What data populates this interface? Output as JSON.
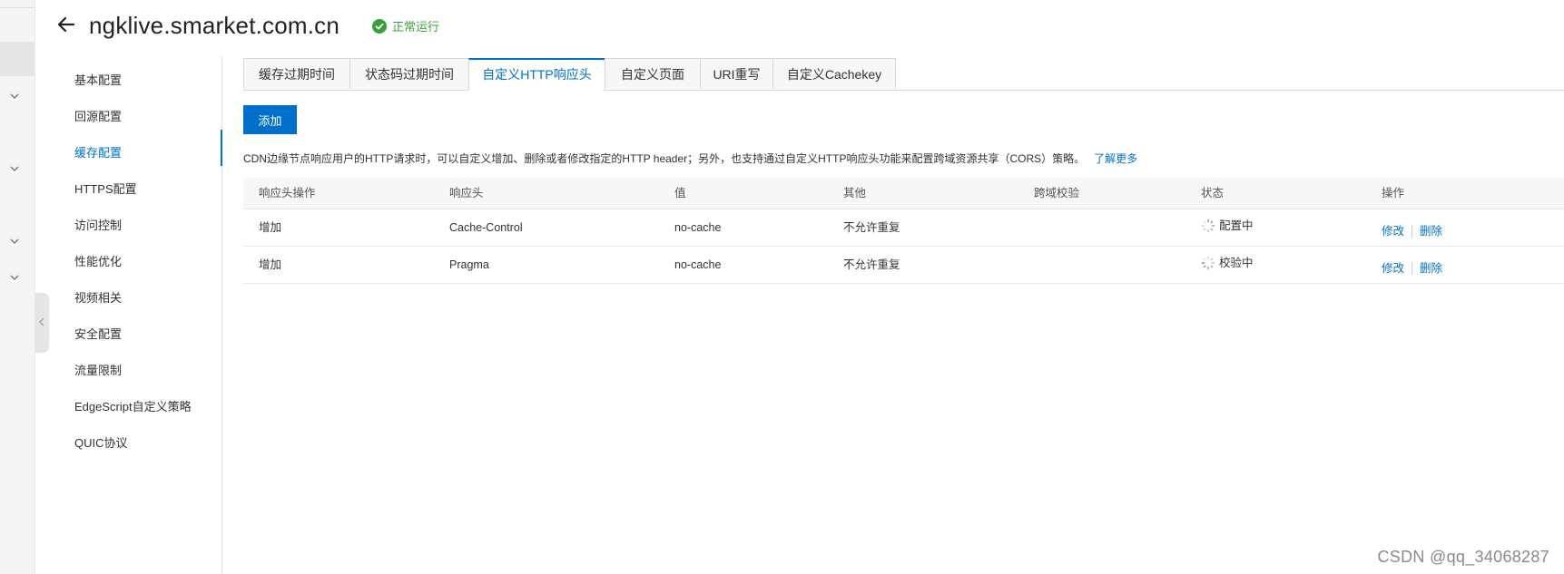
{
  "header": {
    "domain": "ngklive.smarket.com.cn",
    "status": "正常运行"
  },
  "side_nav": {
    "items": [
      {
        "label": "基本配置"
      },
      {
        "label": "回源配置"
      },
      {
        "label": "缓存配置",
        "active": true
      },
      {
        "label": "HTTPS配置"
      },
      {
        "label": "访问控制"
      },
      {
        "label": "性能优化"
      },
      {
        "label": "视频相关"
      },
      {
        "label": "安全配置"
      },
      {
        "label": "流量限制"
      },
      {
        "label": "EdgeScript自定义策略"
      },
      {
        "label": "QUIC协议"
      }
    ]
  },
  "tabs": [
    {
      "label": "缓存过期时间"
    },
    {
      "label": "状态码过期时间"
    },
    {
      "label": "自定义HTTP响应头",
      "active": true
    },
    {
      "label": "自定义页面"
    },
    {
      "label": "URI重写"
    },
    {
      "label": "自定义Cachekey"
    }
  ],
  "toolbar": {
    "add_label": "添加"
  },
  "description": {
    "text": "CDN边缘节点响应用户的HTTP请求时，可以自定义增加、删除或者修改指定的HTTP header；另外，也支持通过自定义HTTP响应头功能来配置跨域资源共享（CORS）策略。",
    "link": "了解更多"
  },
  "table": {
    "columns": [
      "响应头操作",
      "响应头",
      "值",
      "其他",
      "跨域校验",
      "状态",
      "操作"
    ],
    "rows": [
      {
        "action": "增加",
        "header": "Cache-Control",
        "value": "no-cache",
        "other": "不允许重复",
        "cors": "",
        "status": "配置中",
        "edit": "修改",
        "delete": "删除"
      },
      {
        "action": "增加",
        "header": "Pragma",
        "value": "no-cache",
        "other": "不允许重复",
        "cors": "",
        "status": "校验中",
        "edit": "修改",
        "delete": "删除"
      }
    ]
  },
  "watermark": "CSDN @qq_34068287",
  "colors": {
    "accent": "#0070cc",
    "success": "#3a9f3a"
  },
  "icons": [
    "back-arrow-icon",
    "check-circle-icon",
    "chevron-down-icon",
    "chevron-left-icon",
    "loading-spinner-icon"
  ]
}
